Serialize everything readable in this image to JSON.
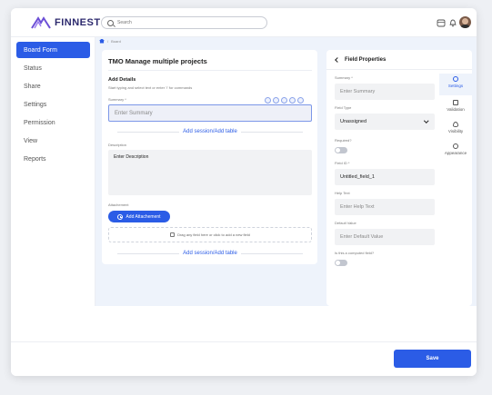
{
  "brand": {
    "name": "FINNEST"
  },
  "search": {
    "placeholder": "Search"
  },
  "header": {
    "icons": [
      "calendar-icon",
      "bell-icon",
      "user-avatar"
    ]
  },
  "sidebar": {
    "items": [
      {
        "label": "Board Form",
        "active": true
      },
      {
        "label": "Status",
        "active": false
      },
      {
        "label": "Share",
        "active": false
      },
      {
        "label": "Settings",
        "active": false
      },
      {
        "label": "Permission",
        "active": false
      },
      {
        "label": "View",
        "active": false
      },
      {
        "label": "Reports",
        "active": false
      }
    ]
  },
  "breadcrumb": {
    "label": "Board"
  },
  "form": {
    "title": "TMO Manage multiple projects",
    "section_title": "Add Details",
    "section_sub": "Start typing and select text or enter '/' for commands",
    "summary_label": "Summary *",
    "summary_placeholder": "Enter Summary",
    "add_session": "Add session/Add table",
    "description_label": "Description",
    "description_placeholder": "Enter Description",
    "attachment_label": "Attachement",
    "attach_button": "Add Attachement",
    "drop_text": "Drag any field here or click to add a new field"
  },
  "properties": {
    "title": "Field Properties",
    "summary_label": "Summary *",
    "summary_placeholder": "Enter Summary",
    "field_type_label": "Field Type",
    "field_type_value": "Unassigned",
    "required_label": "Required?",
    "field_id_label": "Field ID *",
    "field_id_value": "Untitled_field_1",
    "help_text_label": "Help Text",
    "help_text_placeholder": "Enter Help Text",
    "default_value_label": "Default Value",
    "default_value_placeholder": "Enter Default Value",
    "computed_label": "Is this a computed field?",
    "tabs": [
      {
        "label": "Settings",
        "active": true
      },
      {
        "label": "Validation",
        "active": false
      },
      {
        "label": "Visibility",
        "active": false
      },
      {
        "label": "Appearance",
        "active": false
      }
    ]
  },
  "footer": {
    "save_label": "Save"
  },
  "colors": {
    "accent": "#2b5ce6",
    "background": "#eef3fb"
  }
}
